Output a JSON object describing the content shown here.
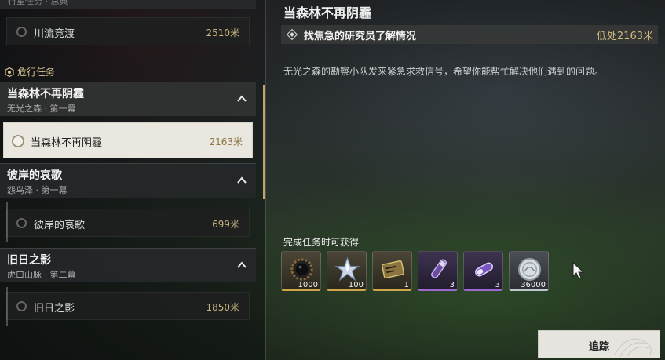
{
  "previous_group": {
    "stub_text": "行星任务 · 总典"
  },
  "items_top": {
    "name": "川流竞渡",
    "distance": "2510米"
  },
  "section": {
    "title": "危行任务",
    "icon": "hex-gear-icon"
  },
  "groups": [
    {
      "title": "当森林不再阴霾",
      "subtitle": "无光之森 · 第一幕",
      "item": {
        "name": "当森林不再阴霾",
        "distance": "2163米"
      }
    },
    {
      "title": "彼岸的哀歌",
      "subtitle": "怨鸟泽 · 第一幕",
      "item": {
        "name": "彼岸的哀歌",
        "distance": "699米"
      }
    },
    {
      "title": "旧日之影",
      "subtitle": "虎口山脉 · 第二幕",
      "item": {
        "name": "旧日之影",
        "distance": "1850米"
      }
    }
  ],
  "detail": {
    "quest_name": "当森林不再阴霾",
    "objective": "找焦急的研究员了解情况",
    "objective_distance": "低处2163米",
    "description": "无光之森的勘察小队发来紧急求救信号，希望你能帮忙解决他们遇到的问题。"
  },
  "rewards": {
    "label": "完成任务时可获得",
    "items": [
      {
        "icon": "gear-core-icon",
        "qty": "1000",
        "rarity": "gold"
      },
      {
        "icon": "crystal-shard-icon",
        "qty": "100",
        "rarity": "gold"
      },
      {
        "icon": "ticket-icon",
        "qty": "1",
        "rarity": "gold"
      },
      {
        "icon": "purple-vial-icon",
        "qty": "3",
        "rarity": "purple"
      },
      {
        "icon": "purple-capsule-icon",
        "qty": "3",
        "rarity": "purple"
      },
      {
        "icon": "silver-coin-icon",
        "qty": "36000",
        "rarity": "silver"
      }
    ]
  },
  "track_button": {
    "label": "追踪"
  },
  "colors": {
    "accent_gold": "#bfa669",
    "distance_gold": "#d1ba7c"
  }
}
